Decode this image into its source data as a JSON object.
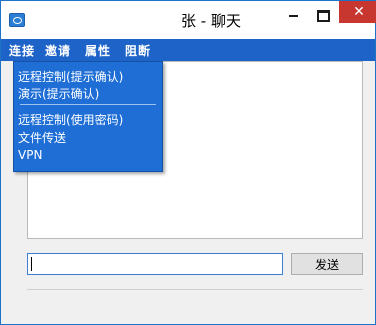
{
  "window": {
    "title": "张 - 聊天",
    "close_symbol": "✕"
  },
  "menubar": {
    "items": [
      {
        "label": "连接"
      },
      {
        "label": "邀请"
      },
      {
        "label": "属性"
      },
      {
        "label": "阻断"
      }
    ]
  },
  "dropdown": {
    "items": [
      {
        "label": "远程控制(提示确认)"
      },
      {
        "label": "演示(提示确认)"
      },
      {
        "label": "远程控制(使用密码)"
      },
      {
        "label": "文件传送"
      },
      {
        "label": "VPN"
      }
    ]
  },
  "chat": {
    "input_value": ""
  },
  "buttons": {
    "send_label": "发送"
  },
  "colors": {
    "accent": "#1e64c8",
    "dropdown_bg": "#1e6ed6",
    "close": "#c7372f"
  }
}
